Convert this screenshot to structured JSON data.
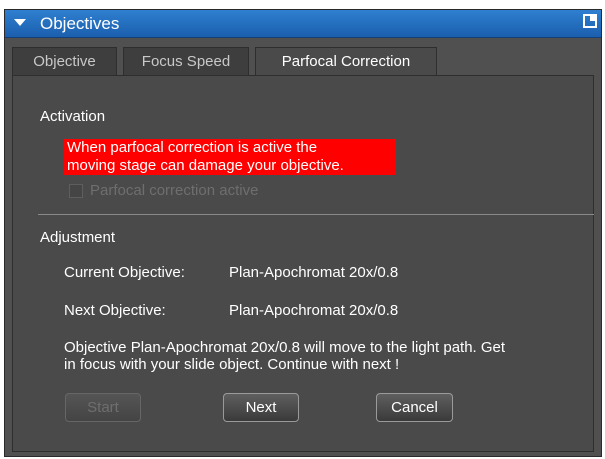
{
  "panel": {
    "title": "Objectives",
    "icons": [
      "collapse-arrow-icon",
      "popout-icon"
    ]
  },
  "tabs": [
    {
      "label": "Objective",
      "active": false
    },
    {
      "label": "Focus Speed",
      "active": false
    },
    {
      "label": "Parfocal Correction",
      "active": true
    }
  ],
  "activation": {
    "heading": "Activation",
    "warning_line1": "When parfocal correction is active the",
    "warning_line2": "moving stage can damage your objective.",
    "checkbox_label": "Parfocal correction active",
    "checkbox_checked": false,
    "checkbox_enabled": false
  },
  "adjustment": {
    "heading": "Adjustment",
    "current_label": "Current Objective:",
    "current_value": "Plan-Apochromat 20x/0.8",
    "next_label": "Next Objective:",
    "next_value": "Plan-Apochromat 20x/0.8",
    "message_line1": "Objective Plan-Apochromat 20x/0.8 will move to the light path. Get",
    "message_line2": "in focus with your slide object. Continue with next !"
  },
  "buttons": {
    "start": "Start",
    "next": "Next",
    "cancel": "Cancel"
  },
  "colors": {
    "title_bar": "#1b5fae",
    "panel_bg": "#4a4a4a",
    "warning_bg": "#ff0000"
  }
}
